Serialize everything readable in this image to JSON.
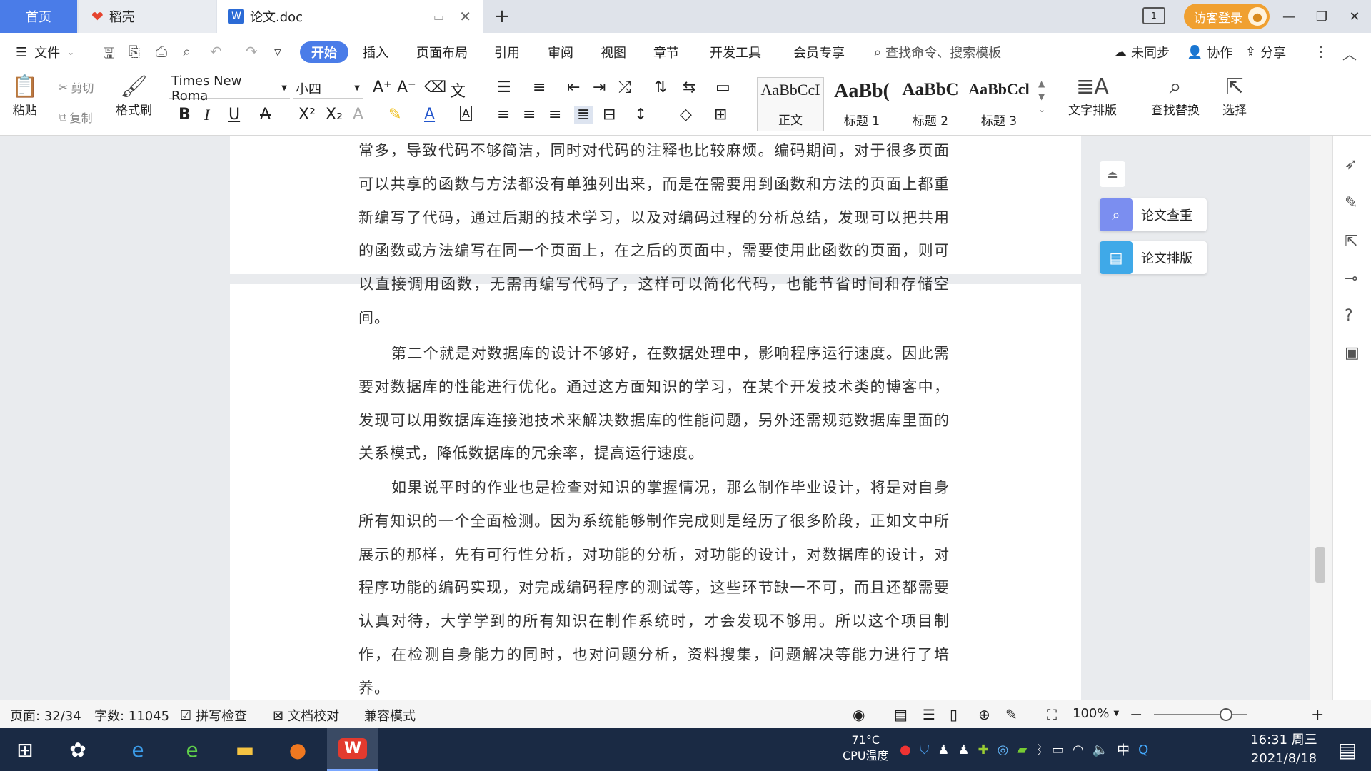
{
  "tabs": {
    "home": "首页",
    "daoke": "稻壳",
    "doc": "论文.doc"
  },
  "account": {
    "visitor_login": "访客登录"
  },
  "menubar": {
    "file": "文件",
    "items": [
      "开始",
      "插入",
      "页面布局",
      "引用",
      "审阅",
      "视图",
      "章节",
      "开发工具",
      "会员专享"
    ],
    "search_placeholder": "查找命令、搜索模板",
    "unsynced": "未同步",
    "collab": "协作",
    "share": "分享"
  },
  "ribbon": {
    "paste": "粘贴",
    "cut": "剪切",
    "copy": "复制",
    "format_painter": "格式刷",
    "font_name": "Times New Roma",
    "font_size": "小四",
    "styles": [
      {
        "sample": "AaBbCcI",
        "name": "正文"
      },
      {
        "sample": "AaBb(",
        "name": "标题 1"
      },
      {
        "sample": "AaBbC",
        "name": "标题 2"
      },
      {
        "sample": "AaBbCcl",
        "name": "标题 3"
      }
    ],
    "text_layout": "文字排版",
    "find_replace": "查找替换",
    "select": "选择"
  },
  "document": {
    "p1": "常多，导致代码不够简洁，同时对代码的注释也比较麻烦。编码期间，对于很多页面可以共享的函数与方法都没有单独列出来，而是在需要用到函数和方法的页面上都重新编写了代码，通过后期的技术学习，以及对编码过程的分析总结，发现可以把共用的函数或方法编写在同一个页面上，在之后的页面中，需要使用此函数的页面，则可以直接调用函数，无需再编写代码了，这样可以简化代码，也能节省时间和存储空间。",
    "p2": "第二个就是对数据库的设计不够好，在数据处理中，影响程序运行速度。因此需要对数据库的性能进行优化。通过这方面知识的学习，在某个开发技术类的博客中，发现可以用数据库连接池技术来解决数据库的性能问题，另外还需规范数据库里面的关系模式，降低数据库的冗余率，提高运行速度。",
    "p3": "如果说平时的作业也是检查对知识的掌握情况，那么制作毕业设计，将是对自身所有知识的一个全面检测。因为系统能够制作完成则是经历了很多阶段，正如文中所展示的那样，先有可行性分析，对功能的分析，对功能的设计，对数据库的设计，对程序功能的编码实现，对完成编码程序的测试等，这些环节缺一不可，而且还都需要认真对待，大学学到的所有知识在制作系统时，才会发现不够用。所以这个项目制作，在检测自身能力的同时，也对问题分析，资料搜集，问题解决等能力进行了培养。"
  },
  "sidepanel": {
    "check": "论文查重",
    "layout": "论文排版"
  },
  "statusbar": {
    "page": "页面: 32/34",
    "words": "字数: 11045",
    "spell": "拼写检查",
    "proof": "文档校对",
    "compat": "兼容模式",
    "zoom": "100%"
  },
  "taskbar": {
    "cpu_temp": "71°C",
    "cpu_label": "CPU温度",
    "ime": "中",
    "time": "16:31 周三",
    "date": "2021/8/18"
  },
  "colors": {
    "accent": "#4a7ce8",
    "visitor": "#f0a030",
    "taskbar": "#1a2a44"
  }
}
